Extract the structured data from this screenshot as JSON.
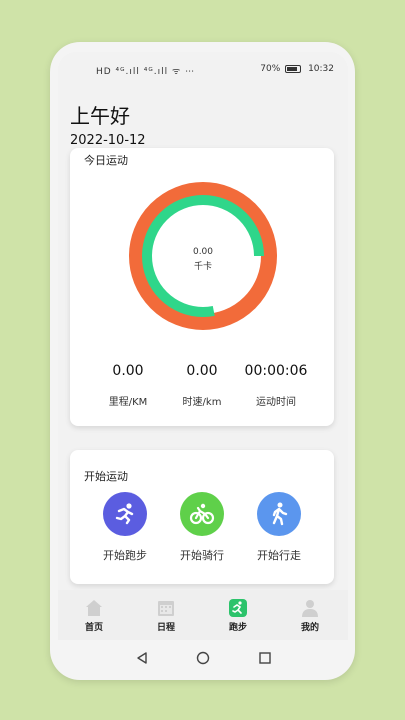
{
  "status_bar": {
    "left_icons": "HD ⁴ᴳ.ıll ⁴ᴳ.ıll ᯤ ⋯",
    "battery": "70%",
    "time": "10:32"
  },
  "header": {
    "greeting": "上午好",
    "date": "2022-10-12"
  },
  "today_card": {
    "title": "今日运动",
    "ring": {
      "value": "0.00",
      "unit": "千卡",
      "outer_color": "#f26b3a",
      "inner_color": "#2fd68a",
      "inner_progress": 0.78
    },
    "stats": [
      {
        "value": "0.00",
        "label": "里程/KM"
      },
      {
        "value": "0.00",
        "label": "时速/km"
      },
      {
        "value": "00:00:06",
        "label": "运动时间"
      }
    ]
  },
  "start_card": {
    "title": "开始运动",
    "actions": [
      {
        "label": "开始跑步",
        "icon": "running-icon",
        "color": "#5b5de0"
      },
      {
        "label": "开始骑行",
        "icon": "cycling-icon",
        "color": "#5fd04a"
      },
      {
        "label": "开始行走",
        "icon": "walking-icon",
        "color": "#5b96ee"
      }
    ]
  },
  "tabs": [
    {
      "label": "首页",
      "icon": "home-icon"
    },
    {
      "label": "日程",
      "icon": "calendar-icon"
    },
    {
      "label": "跑步",
      "icon": "running-icon",
      "active": true,
      "color": "#2cc36b"
    },
    {
      "label": "我的",
      "icon": "user-icon"
    }
  ]
}
